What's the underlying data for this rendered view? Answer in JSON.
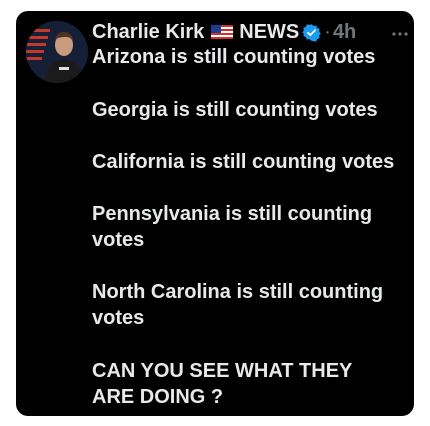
{
  "tweet": {
    "author_name": "Charlie Kirk",
    "badge_text": "NEWS",
    "separator": "·",
    "time": "4h",
    "lines": [
      "Arizona is still counting votes",
      "Georgia is still counting votes",
      "California is still counting votes",
      "Pennsylvania is still counting votes",
      "North Carolina is still counting votes",
      "CAN YOU SEE WHAT THEY ARE DOING ?"
    ]
  },
  "colors": {
    "background": "#000000",
    "text": "#e7e9ea",
    "muted": "#71767b",
    "verified": "#1d9bf0"
  },
  "icons": {
    "flag": "us-flag-icon",
    "verified": "verified-badge-icon",
    "more": "more-options-icon"
  }
}
